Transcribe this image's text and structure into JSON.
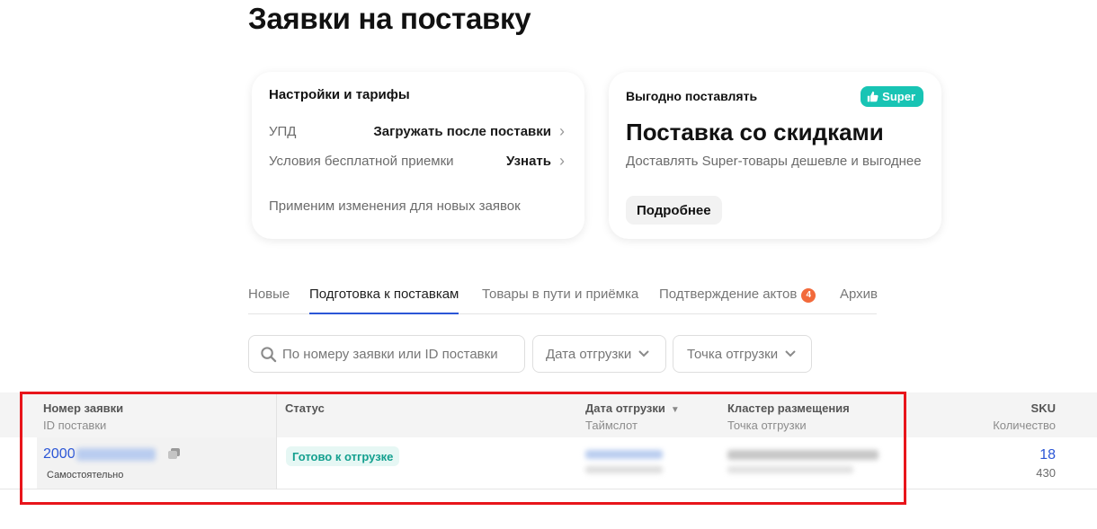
{
  "page": {
    "title": "Заявки на поставку"
  },
  "settings_card": {
    "title": "Настройки и тарифы",
    "rows": [
      {
        "label": "УПД",
        "value": "Загружать после поставки"
      },
      {
        "label": "Условия бесплатной приемки",
        "value": "Узнать"
      }
    ],
    "note": "Применим изменения для новых заявок"
  },
  "promo_card": {
    "subtitle": "Выгодно поставлять",
    "badge": "Super",
    "title": "Поставка со скидками",
    "description": "Доставлять Super-товары дешевле и выгоднее",
    "button": "Подробнее",
    "accent_color": "#18c4b4"
  },
  "tabs": [
    {
      "label": "Новые",
      "active": false
    },
    {
      "label": "Подготовка к поставкам",
      "active": true
    },
    {
      "label": "Товары в пути и приёмка",
      "active": false
    },
    {
      "label": "Подтверждение актов",
      "active": false,
      "count": "4"
    },
    {
      "label": "Архив",
      "active": false
    }
  ],
  "filters": {
    "search_placeholder": "По номеру заявки или ID поставки",
    "date": "Дата отгрузки",
    "point": "Точка отгрузки"
  },
  "table": {
    "headers": {
      "order": {
        "title": "Номер заявки",
        "sub": "ID поставки"
      },
      "status": {
        "title": "Статус"
      },
      "date": {
        "title": "Дата отгрузки",
        "sub": "Таймслот"
      },
      "cluster": {
        "title": "Кластер размещения",
        "sub": "Точка отгрузки"
      },
      "sku": {
        "title": "SKU",
        "sub": "Количество"
      }
    },
    "rows": [
      {
        "order_number": "2000",
        "mode": "Самостоятельно",
        "status": "Готово к отгрузке",
        "sku": "18",
        "quantity": "430"
      }
    ]
  },
  "colors": {
    "link": "#2b56d6",
    "status_text": "#14a08f",
    "status_bg": "#e6f7f4",
    "badge_count": "#f26a3b",
    "highlight": "#e8151b"
  }
}
